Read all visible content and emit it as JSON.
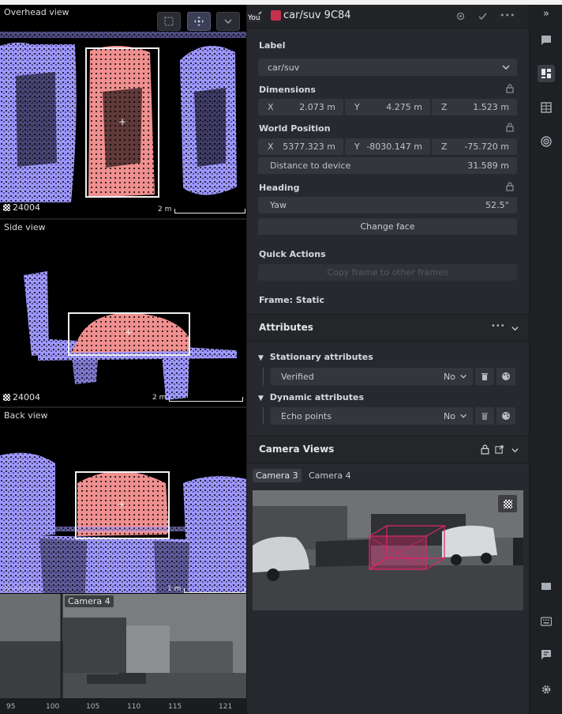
{
  "viewports": {
    "overhead": {
      "title": "Overhead view",
      "frame": "24004",
      "scale": "2 m"
    },
    "side": {
      "title": "Side view",
      "frame": "24004",
      "scale": "2 m"
    },
    "back": {
      "title": "Back view",
      "frame": "24004",
      "scale": "1 m"
    },
    "camera_strip_label": "Camera 4",
    "timeline": [
      "95",
      "100",
      "105",
      "110",
      "115",
      "121"
    ]
  },
  "header": {
    "you_badge": "You",
    "title": "car/suv 9C84",
    "swatch_color": "#c4314f"
  },
  "label_section": {
    "label": "Label",
    "value": "car/suv"
  },
  "dimensions": {
    "label": "Dimensions",
    "x_key": "X",
    "x": "2.073 m",
    "y_key": "Y",
    "y": "4.275 m",
    "z_key": "Z",
    "z": "1.523 m"
  },
  "world_position": {
    "label": "World Position",
    "x_key": "X",
    "x": "5377.323 m",
    "y_key": "Y",
    "y": "-8030.147 m",
    "z_key": "Z",
    "z": "-75.720 m",
    "distance_key": "Distance to device",
    "distance": "31.589 m"
  },
  "heading": {
    "label": "Heading",
    "yaw_key": "Yaw",
    "yaw": "52.5°",
    "change_face": "Change face"
  },
  "quick_actions": {
    "label": "Quick Actions",
    "copy_frame": "Copy frame to other frames"
  },
  "frame": {
    "label": "Frame: Static"
  },
  "attributes": {
    "title": "Attributes",
    "stationary_label": "Stationary attributes",
    "stationary": [
      {
        "name": "Verified",
        "value": "No"
      }
    ],
    "dynamic_label": "Dynamic attributes",
    "dynamic": [
      {
        "name": "Echo points",
        "value": "No"
      }
    ]
  },
  "camera_views": {
    "title": "Camera Views",
    "tabs": [
      "Camera 3",
      "Camera 4"
    ]
  },
  "colors": {
    "points": "#9d97ff",
    "object": "#ef8f8f",
    "box_3d": "#e0246a"
  }
}
